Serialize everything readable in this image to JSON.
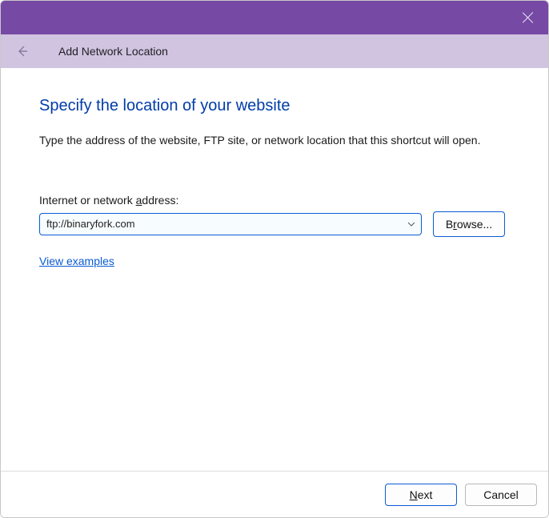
{
  "titlebar": {},
  "subheader": {
    "title": "Add Network Location"
  },
  "content": {
    "page_title": "Specify the location of your website",
    "instruction": "Type the address of the website, FTP site, or network location that this shortcut will open.",
    "field_label_pre": "Internet or network ",
    "field_label_ul": "a",
    "field_label_post": "ddress:",
    "address_value": "ftp://binaryfork.com",
    "browse_pre": "B",
    "browse_ul": "r",
    "browse_post": "owse...",
    "examples_label": "View examples"
  },
  "footer": {
    "next_ul": "N",
    "next_post": "ext",
    "cancel_label": "Cancel"
  }
}
